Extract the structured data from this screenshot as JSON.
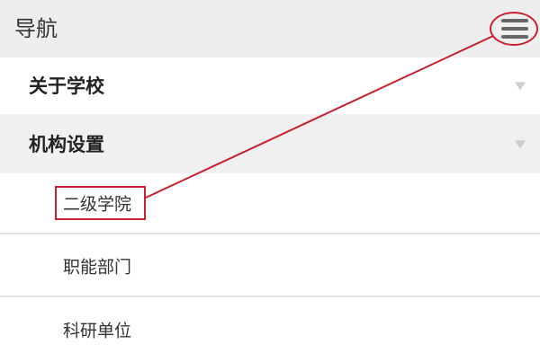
{
  "header": {
    "title": "导航",
    "menu_icon": "hamburger-menu-icon"
  },
  "nav": {
    "items": [
      {
        "label": "关于学校",
        "expanded": false
      },
      {
        "label": "机构设置",
        "expanded": true,
        "children": [
          "二级学院",
          "职能部门",
          "科研单位"
        ]
      }
    ]
  },
  "annotation": {
    "color": "#c8202e",
    "target": "二级学院"
  }
}
